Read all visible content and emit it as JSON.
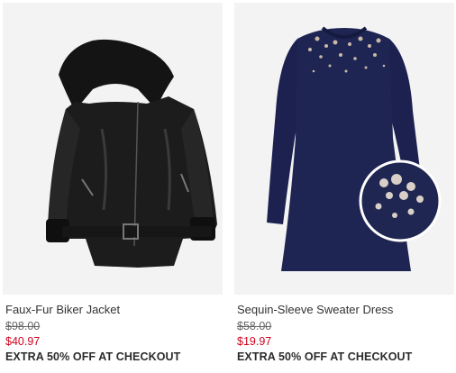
{
  "products": [
    {
      "name": "Faux-Fur Biker Jacket",
      "original_price": "$98.00",
      "sale_price": "$40.97",
      "promo": "EXTRA 50% OFF AT CHECKOUT"
    },
    {
      "name": "Sequin-Sleeve Sweater Dress",
      "original_price": "$58.00",
      "sale_price": "$19.97",
      "promo": "EXTRA 50% OFF AT CHECKOUT"
    }
  ],
  "colors": {
    "sale_red": "#d0021b",
    "image_bg": "#f3f3f3",
    "jacket": "#1c1c1c",
    "dress": "#1f2552"
  }
}
